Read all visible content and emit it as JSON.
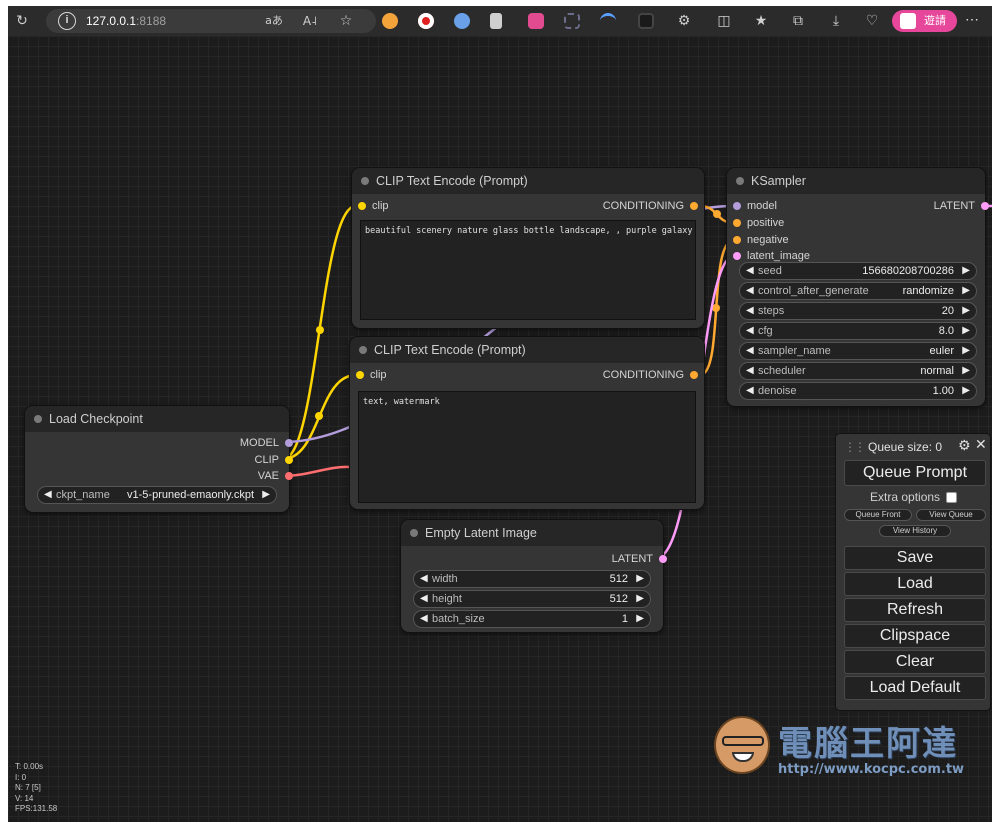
{
  "browser": {
    "address_host": "127.0.0.1",
    "address_port": ":8188",
    "signin_label": "遊請",
    "icons": [
      "refresh-icon",
      "info-icon",
      "translate-icon",
      "read-aloud-icon",
      "favorite-icon",
      "split-screen-icon",
      "favorites-icon",
      "collections-icon",
      "download-icon",
      "health-icon",
      "more-icon"
    ]
  },
  "nodes": {
    "clip_top": {
      "title": "CLIP Text Encode (Prompt)",
      "input": "clip",
      "output": "CONDITIONING",
      "text": "beautiful scenery nature glass bottle landscape, , purple galaxy bottle,"
    },
    "clip_bottom": {
      "title": "CLIP Text Encode (Prompt)",
      "input": "clip",
      "output": "CONDITIONING",
      "text": "text, watermark"
    },
    "ksampler": {
      "title": "KSampler",
      "inputs": [
        "model",
        "positive",
        "negative",
        "latent_image"
      ],
      "output": "LATENT",
      "widgets": [
        {
          "name": "seed",
          "value": "156680208700286"
        },
        {
          "name": "control_after_generate",
          "value": "randomize"
        },
        {
          "name": "steps",
          "value": "20"
        },
        {
          "name": "cfg",
          "value": "8.0"
        },
        {
          "name": "sampler_name",
          "value": "euler"
        },
        {
          "name": "scheduler",
          "value": "normal"
        },
        {
          "name": "denoise",
          "value": "1.00"
        }
      ]
    },
    "checkpoint": {
      "title": "Load Checkpoint",
      "outputs": [
        "MODEL",
        "CLIP",
        "VAE"
      ],
      "widget": {
        "name": "ckpt_name",
        "value": "v1-5-pruned-emaonly.ckpt"
      }
    },
    "latent": {
      "title": "Empty Latent Image",
      "output": "LATENT",
      "widgets": [
        {
          "name": "width",
          "value": "512"
        },
        {
          "name": "height",
          "value": "512"
        },
        {
          "name": "batch_size",
          "value": "1"
        }
      ]
    }
  },
  "queue_panel": {
    "queue_size": "Queue size: 0",
    "queue_prompt": "Queue Prompt",
    "extra_options": "Extra options",
    "queue_front": "Queue Front",
    "view_queue": "View Queue",
    "view_history": "View History",
    "buttons": [
      "Save",
      "Load",
      "Refresh",
      "Clipspace",
      "Clear",
      "Load Default"
    ]
  },
  "stats": [
    "T: 0.00s",
    "I: 0",
    "N: 7 [5]",
    "V: 14",
    "FPS:131.58"
  ],
  "watermark": {
    "brand": "電腦王阿達",
    "url": "http://www.kocpc.com.tw"
  },
  "colors": {
    "clip": "#ffd500",
    "model": "#b39ddb",
    "conditioning": "#ffa931",
    "latent": "#ff9cf9",
    "vae": "#ff6e6e"
  }
}
